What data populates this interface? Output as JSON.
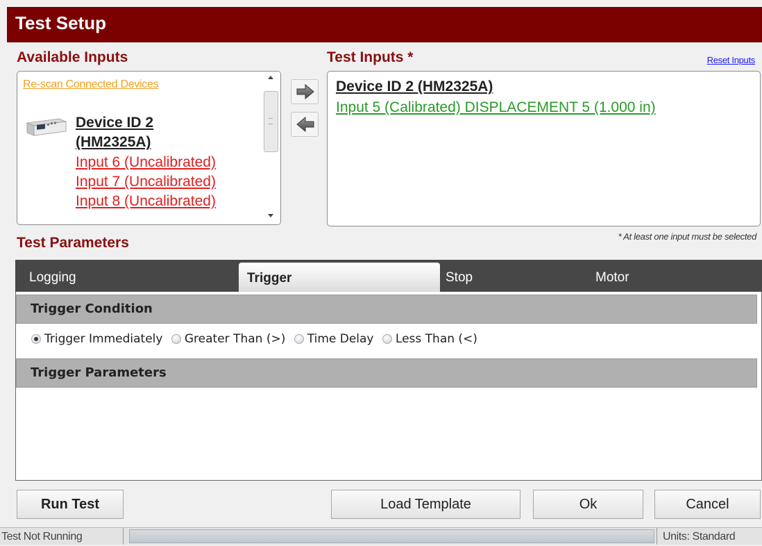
{
  "window": {
    "title": "Test Setup"
  },
  "available_inputs": {
    "title": "Available Inputs",
    "rescan_link": "Re-scan Connected Devices",
    "device": {
      "name_line1": "Device ID 2",
      "name_line2": "(HM2325A)",
      "icon": "device-icon"
    },
    "inputs": [
      "Input 6 (Uncalibrated)",
      "Input 7 (Uncalibrated)",
      "Input 8 (Uncalibrated)"
    ],
    "input_color": "#e02020"
  },
  "transfer": {
    "add_icon": "arrow-right-icon",
    "remove_icon": "arrow-left-icon"
  },
  "test_inputs": {
    "title": "Test Inputs *",
    "reset_link": "Reset Inputs",
    "device": "Device ID 2 (HM2325A)",
    "inputs": [
      "Input 5 (Calibrated) DISPLACEMENT 5 (1.000 in)"
    ],
    "input_color": "#2a9a2a",
    "note": "* At least one input must be selected"
  },
  "test_parameters": {
    "title": "Test Parameters",
    "tabs": [
      {
        "label": "Logging",
        "active": false
      },
      {
        "label": "Trigger",
        "active": true
      },
      {
        "label": "Stop",
        "active": false
      },
      {
        "label": "Motor",
        "active": false
      }
    ],
    "trigger_condition": {
      "header": "Trigger Condition",
      "options": [
        {
          "label": "Trigger Immediately",
          "checked": true
        },
        {
          "label": "Greater Than (>)",
          "checked": false
        },
        {
          "label": "Time Delay",
          "checked": false
        },
        {
          "label": "Less Than (<)",
          "checked": false
        }
      ]
    },
    "trigger_parameters": {
      "header": "Trigger Parameters"
    }
  },
  "buttons": {
    "run": "Run Test",
    "load": "Load Template",
    "ok": "Ok",
    "cancel": "Cancel"
  },
  "status": {
    "left": "Test Not Running",
    "right": "Units: Standard"
  },
  "colors": {
    "title_bar": "#7b0000",
    "section_title": "#8a0f0f",
    "tab_bar": "#474747"
  }
}
